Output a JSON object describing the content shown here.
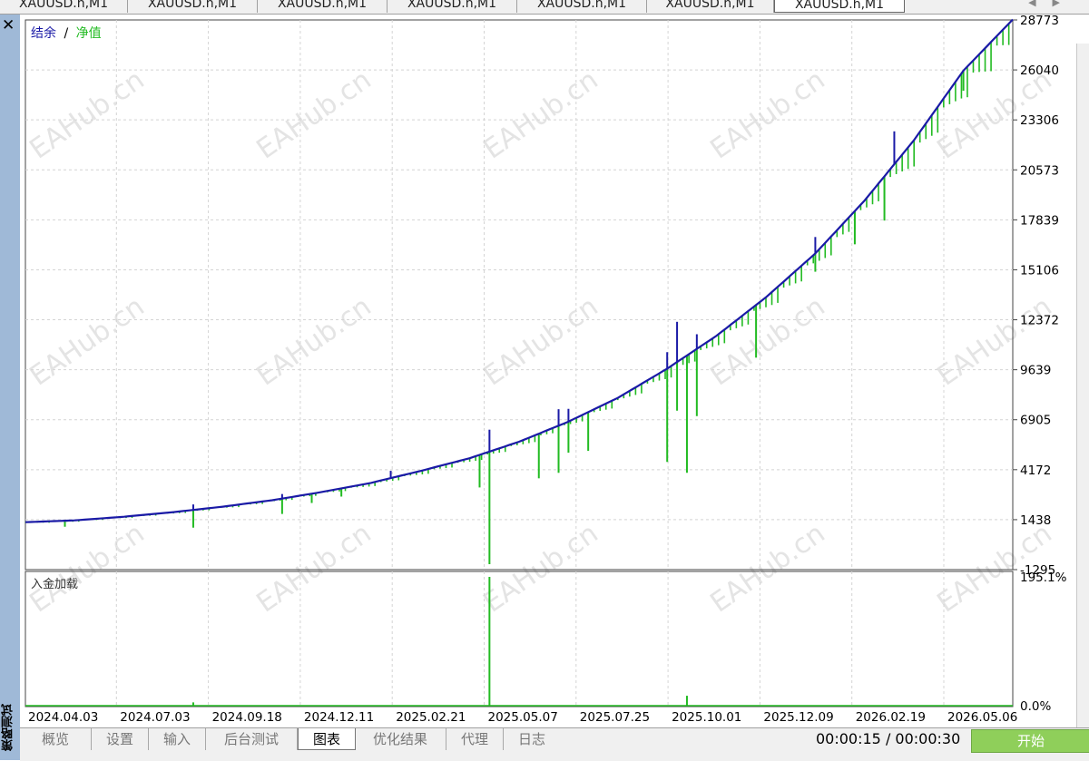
{
  "chart_tabs": [
    "XAUUSD.h,M1",
    "XAUUSD.h,M1",
    "XAUUSD.h,M1",
    "XAUUSD.h,M1",
    "XAUUSD.h,M1",
    "XAUUSD.h,M1",
    "XAUUSD.h,M1"
  ],
  "panel_title": "策略测试",
  "legend": {
    "balance": "结余",
    "separator": "/",
    "equity": "净值"
  },
  "deposit_label": "入金加载",
  "watermark": "EAHub.cn",
  "colors": {
    "balance": "#1a1aa6",
    "equity": "#22bb22",
    "deposit": "#22bb22",
    "grid": "#d0d0d0",
    "button": "#8fcf5a"
  },
  "chart_data": {
    "type": "line",
    "title": "",
    "x_labels": [
      "2024.04.03",
      "2024.07.03",
      "2024.09.18",
      "2024.12.11",
      "2025.02.21",
      "2025.05.07",
      "2025.07.25",
      "2025.10.01",
      "2025.12.09",
      "2026.02.19",
      "2026.05.06"
    ],
    "y_ticks": [
      "28773",
      "26040",
      "23306",
      "20573",
      "17839",
      "15106",
      "12372",
      "9639",
      "6905",
      "4172",
      "1438",
      "-1295"
    ],
    "ylim": [
      -1295,
      28773
    ],
    "series": [
      {
        "name": "结余",
        "points": [
          [
            0,
            1300
          ],
          [
            5,
            1400
          ],
          [
            10,
            1600
          ],
          [
            15,
            1850
          ],
          [
            20,
            2150
          ],
          [
            25,
            2500
          ],
          [
            30,
            2950
          ],
          [
            35,
            3450
          ],
          [
            40,
            4100
          ],
          [
            45,
            4800
          ],
          [
            50,
            5700
          ],
          [
            55,
            6800
          ],
          [
            60,
            8100
          ],
          [
            65,
            9700
          ],
          [
            70,
            11500
          ],
          [
            75,
            13600
          ],
          [
            80,
            16000
          ],
          [
            85,
            18900
          ],
          [
            90,
            22200
          ],
          [
            95,
            26000
          ],
          [
            100,
            28800
          ]
        ]
      },
      {
        "name": "净值",
        "drops": [
          [
            4,
            1050
          ],
          [
            17,
            1000
          ],
          [
            26,
            1750
          ],
          [
            29,
            2350
          ],
          [
            32,
            2700
          ],
          [
            46,
            3200
          ],
          [
            47,
            -1000
          ],
          [
            52,
            3700
          ],
          [
            54,
            4000
          ],
          [
            55,
            5100
          ],
          [
            57,
            5200
          ],
          [
            65,
            4600
          ],
          [
            66,
            7400
          ],
          [
            67,
            4000
          ],
          [
            68,
            7100
          ],
          [
            74,
            10300
          ],
          [
            80,
            15000
          ],
          [
            84,
            16500
          ],
          [
            87,
            17800
          ],
          [
            95,
            24900
          ]
        ]
      }
    ],
    "deposit_load": {
      "y_ticks": [
        "195.1%",
        "0.0%"
      ],
      "spikes": [
        [
          17,
          5
        ],
        [
          47,
          195.1
        ],
        [
          67,
          15
        ]
      ]
    }
  },
  "bottom_tabs": [
    "概览",
    "设置",
    "输入",
    "后台测试",
    "图表",
    "优化结果",
    "代理",
    "日志"
  ],
  "active_tab": "图表",
  "timer": "00:00:15 / 00:00:30",
  "start_button": "开始"
}
